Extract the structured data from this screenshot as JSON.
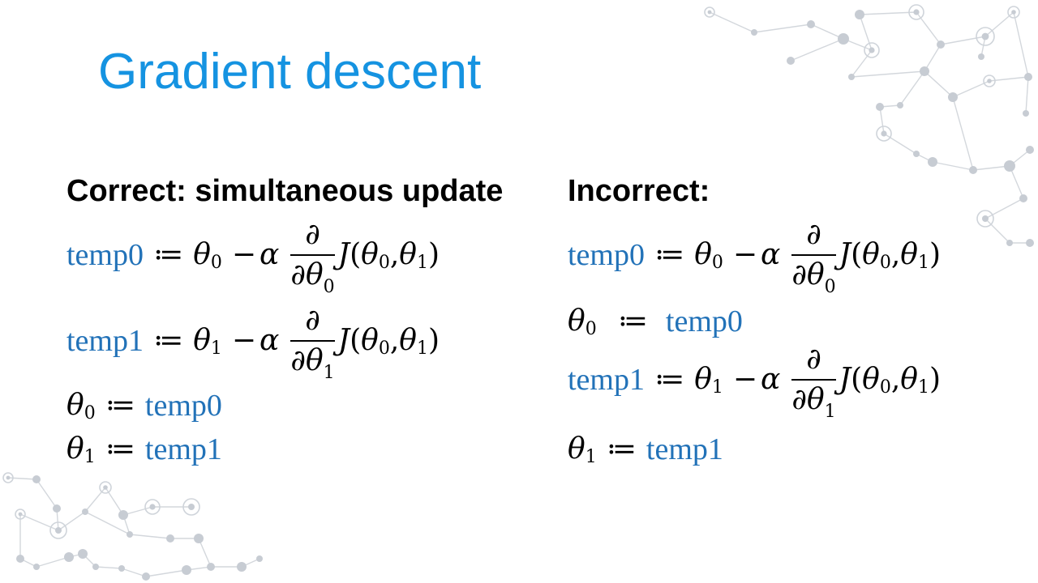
{
  "slide": {
    "title": "Gradient descent",
    "left_heading": "Correct: simultaneous update",
    "right_heading": "Incorrect:",
    "symbols": {
      "assign": "≔",
      "theta": "θ",
      "alpha": "α",
      "partial": "∂",
      "J": "J",
      "minus": "−",
      "open": "(",
      "comma": ",",
      "close": ")",
      "sub0": "0",
      "sub1": "1"
    },
    "left_lines": [
      {
        "kind": "update",
        "target": "temp0",
        "param_sub": "0",
        "deriv_sub": "0"
      },
      {
        "kind": "update",
        "target": "temp1",
        "param_sub": "1",
        "deriv_sub": "1"
      },
      {
        "kind": "assign",
        "param_sub": "0",
        "source": "temp0"
      },
      {
        "kind": "assign",
        "param_sub": "1",
        "source": "temp1"
      }
    ],
    "right_lines": [
      {
        "kind": "update",
        "target": "temp0",
        "param_sub": "0",
        "deriv_sub": "0"
      },
      {
        "kind": "assign",
        "param_sub": "0",
        "source": "temp0"
      },
      {
        "kind": "update",
        "target": "temp1",
        "param_sub": "1",
        "deriv_sub": "1"
      },
      {
        "kind": "assign",
        "param_sub": "1",
        "source": "temp1"
      }
    ],
    "colors": {
      "title": "#1593e1",
      "keyword": "#2272b8",
      "text": "#000000",
      "network": "#c7ccd3"
    }
  }
}
